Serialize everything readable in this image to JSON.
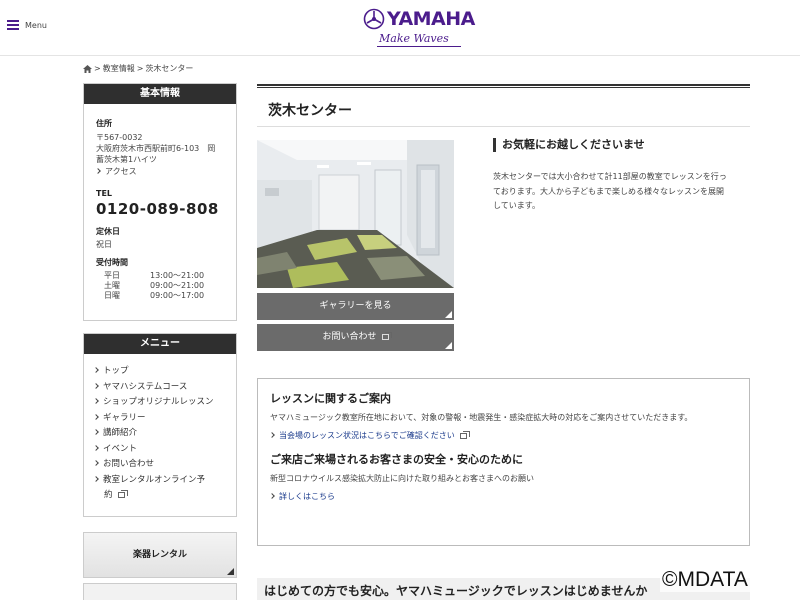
{
  "header": {
    "menu_label": "Menu",
    "logo_text": "YAMAHA",
    "logo_tagline": "Make Waves"
  },
  "breadcrumb": {
    "sep": ">",
    "level1": "教室情報",
    "level2": "茨木センター"
  },
  "sidebar": {
    "info": {
      "title": "基本情報",
      "address_label": "住所",
      "postal": "〒567-0032",
      "address_line1": "大阪府茨木市西駅前町6-103　岡",
      "address_line2": "蓄茨木第1ハイツ",
      "access_link": "アクセス",
      "tel_label": "TEL",
      "tel": "0120-089-808",
      "holiday_label": "定休日",
      "holiday": "祝日",
      "hours_label": "受付時間",
      "hours": [
        {
          "day": "平日",
          "time": "13:00～21:00"
        },
        {
          "day": "土曜",
          "time": "09:00～21:00"
        },
        {
          "day": "日曜",
          "time": "09:00～17:00"
        }
      ]
    },
    "menu": {
      "title": "メニュー",
      "items": [
        "トップ",
        "ヤマハシステムコース",
        "ショップオリジナルレッスン",
        "ギャラリー",
        "講師紹介",
        "イベント",
        "お問い合わせ",
        "教室レンタルオンライン予"
      ],
      "last_item_cont": "約"
    },
    "rental_button": "楽器レンタル"
  },
  "main": {
    "title": "茨木センター",
    "gallery_button": "ギャラリーを見る",
    "contact_button": "お問い合わせ",
    "intro_heading": "お気軽にお越しくださいませ",
    "intro_body": "茨木センターでは大小合わせて計11部屋の教室でレッスンを行っております。大人から子どもまで楽しめる様々なレッスンを展開しています。",
    "notice": {
      "heading1": "レッスンに関するご案内",
      "body1": "ヤマハミュージック教室所在地において、対象の警報・地震発生・感染症拡大時の対応をご案内させていただきます。",
      "link1": "当会場のレッスン状況はこちらでご確認ください",
      "heading2": "ご来店ご来場されるお客さまの安全・安心のために",
      "body2": "新型コロナウイルス感染拡大防止に向けた取り組みとお客さまへのお願い",
      "link2": "詳しくはこちら"
    },
    "bottom_heading": "はじめての方でも安心。ヤマハミュージックでレッスンはじめませんか"
  },
  "watermark": "©MDATA",
  "colors": {
    "brand": "#4b1c8c",
    "side_header": "#2f2f2f",
    "button_gray": "#6b6b6b",
    "link": "#1b3b8c"
  }
}
